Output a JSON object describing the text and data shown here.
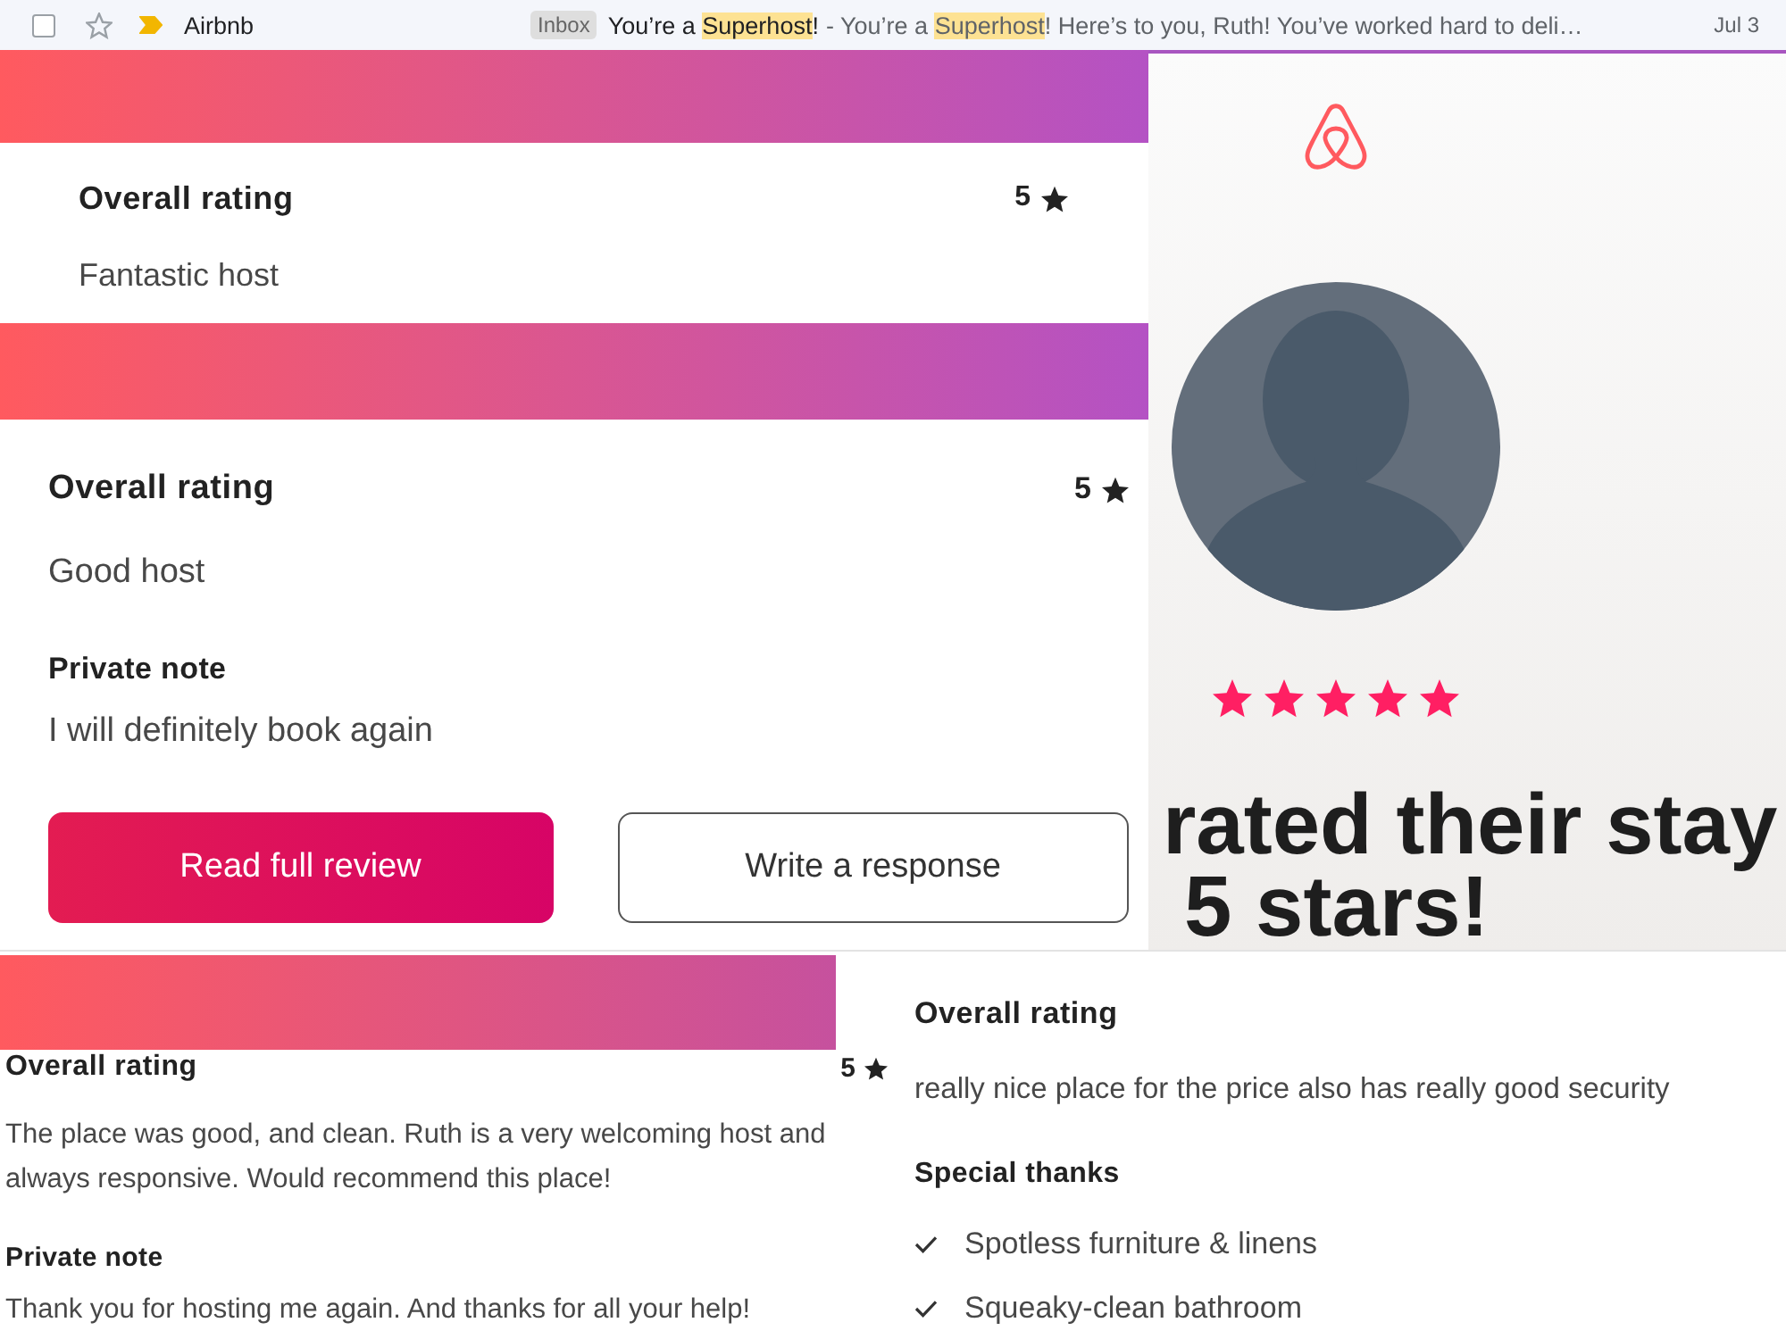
{
  "email_row": {
    "checked": false,
    "starred": false,
    "important": true,
    "sender": "Airbnb",
    "label": "Inbox",
    "subject": [
      {
        "text": "You’re a ",
        "highlight": false
      },
      {
        "text": "Superhost",
        "highlight": true
      },
      {
        "text": "!",
        "highlight": false
      }
    ],
    "snippet": [
      {
        "text": "- You’re a ",
        "highlight": false
      },
      {
        "text": "Superhost",
        "highlight": true
      },
      {
        "text": "! Here’s to you, Ruth! You’ve worked hard to deli…",
        "highlight": false
      }
    ],
    "date": "Jul 3"
  },
  "reviews": [
    {
      "heading": "Overall rating",
      "score": "5",
      "comment": "Fantastic host"
    },
    {
      "heading": "Overall rating",
      "score": "5",
      "comment": "Good host",
      "private_note": {
        "heading": "Private note",
        "text": "I will definitely book again"
      },
      "buttons": [
        {
          "label": "Read full review",
          "kind": "primary"
        },
        {
          "label": "Write a response",
          "kind": "secondary"
        }
      ]
    }
  ],
  "promo": {
    "stars": 5,
    "headline": [
      "rated their stay",
      "5 stars!"
    ]
  },
  "bottom_reviews": [
    {
      "heading": "Overall rating",
      "score": "5",
      "comment": "The place was good, and clean. Ruth is a very welcoming host and always responsive. Would recommend this place!",
      "private_note": {
        "heading": "Private note",
        "text": "Thank you for hosting me again. And thanks for all your help!"
      }
    },
    {
      "heading": "Overall rating",
      "comment": "really nice place for the price also has really good security",
      "special_thanks": {
        "heading": "Special thanks",
        "items": [
          "Spotless furniture & linens",
          "Squeaky-clean bathroom"
        ]
      }
    }
  ]
}
